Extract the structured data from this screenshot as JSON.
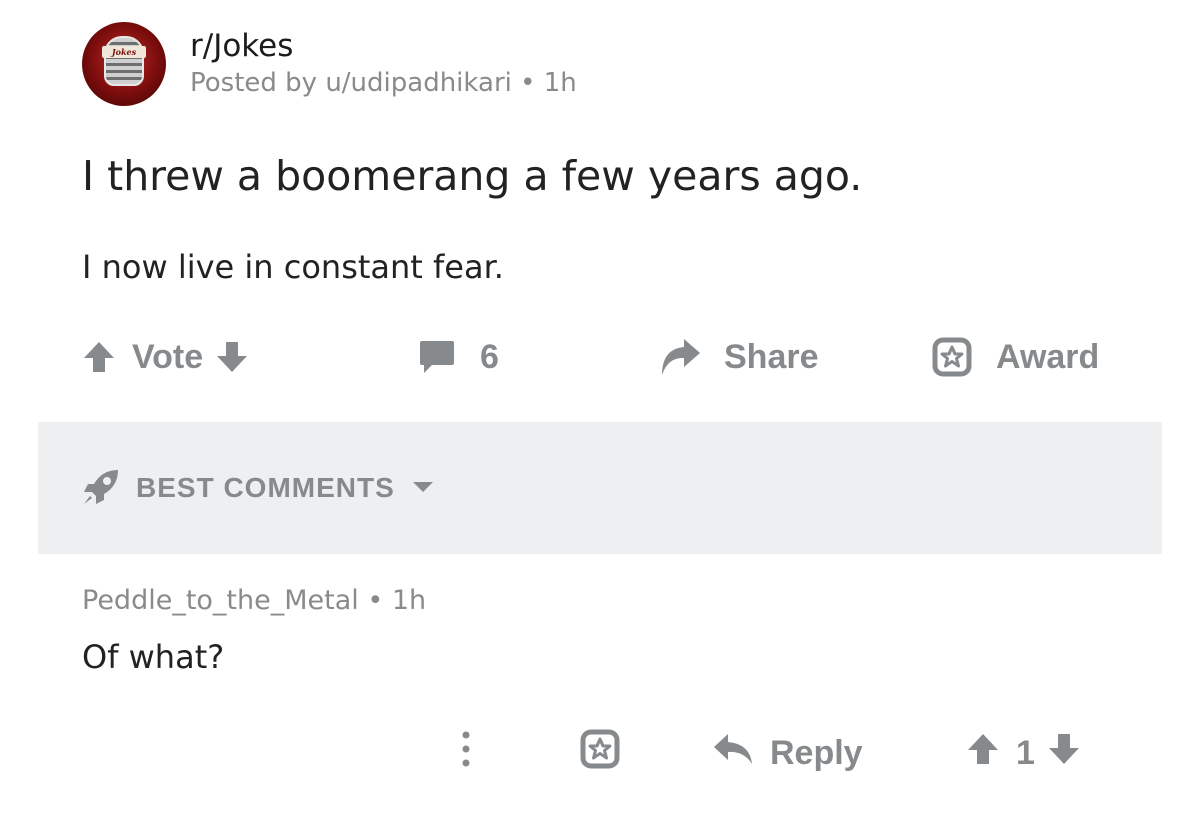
{
  "post": {
    "subreddit": "r/Jokes",
    "avatar_text": "Jokes",
    "meta": "Posted by u/udipadhikari • 1h",
    "title": "I threw a boomerang a few years ago.",
    "body": "I now live in constant fear."
  },
  "actions": {
    "vote_label": "Vote",
    "comment_count": "6",
    "share_label": "Share",
    "award_label": "Award"
  },
  "sort": {
    "label": "BEST COMMENTS"
  },
  "comment": {
    "meta": "Peddle_to_the_Metal • 1h",
    "body": "Of what?",
    "reply_label": "Reply",
    "score": "1"
  },
  "icons": {
    "upvote": "arrow-up-icon",
    "downvote": "arrow-down-icon",
    "comments": "speech-bubble-icon",
    "share": "share-arrow-icon",
    "award": "award-star-icon",
    "sort": "rocket-icon",
    "more": "more-vertical-icon",
    "reply": "reply-arrow-icon"
  },
  "colors": {
    "icon_gray": "#878a8c",
    "sort_bar_bg": "#edeff1",
    "meta_gray": "#8a8a8a"
  }
}
